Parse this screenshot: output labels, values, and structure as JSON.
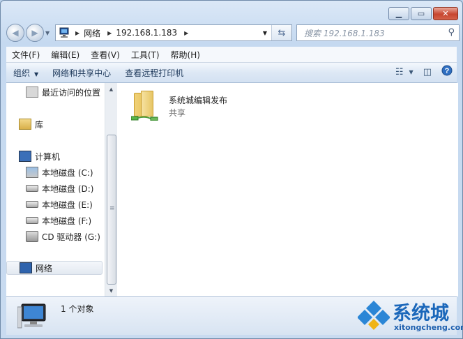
{
  "window": {
    "minimize_icon": "minimize-icon",
    "maximize_icon": "maximize-icon",
    "close_icon": "close-icon"
  },
  "nav": {
    "back_icon": "back-arrow-icon",
    "forward_icon": "forward-arrow-icon",
    "address_crumbs": [
      "网络",
      "192.168.1.183"
    ],
    "search_placeholder": "搜索 192.168.1.183"
  },
  "menubar": {
    "items": [
      "文件(F)",
      "编辑(E)",
      "查看(V)",
      "工具(T)",
      "帮助(H)"
    ]
  },
  "commandbar": {
    "organize": "组织",
    "network_center": "网络和共享中心",
    "remote_printers": "查看远程打印机"
  },
  "navpane": {
    "items": [
      {
        "label": "最近访问的位置",
        "icon": "recent-places-icon"
      },
      {
        "label": "库",
        "icon": "library-icon"
      },
      {
        "label": "计算机",
        "icon": "computer-icon"
      },
      {
        "label": "本地磁盘 (C:)",
        "icon": "system-drive-icon"
      },
      {
        "label": "本地磁盘 (D:)",
        "icon": "drive-icon"
      },
      {
        "label": "本地磁盘 (E:)",
        "icon": "drive-icon"
      },
      {
        "label": "本地磁盘 (F:)",
        "icon": "drive-icon"
      },
      {
        "label": "CD 驱动器 (G:)",
        "icon": "cd-drive-icon"
      },
      {
        "label": "网络",
        "icon": "network-icon"
      }
    ]
  },
  "content": {
    "share_name": "系统城编辑发布",
    "share_sub": "共享"
  },
  "status": {
    "count_text": "1 个对象"
  },
  "watermark": {
    "brand": "系统城",
    "url": "xitongcheng.com"
  },
  "colors": {
    "frame": "#c5d9f0",
    "accent": "#1d6cc1",
    "close": "#c7452f"
  }
}
